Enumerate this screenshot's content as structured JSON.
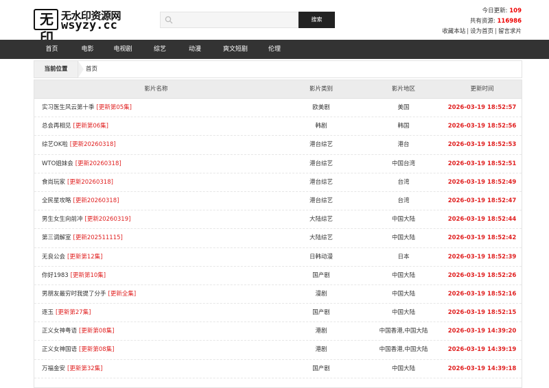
{
  "logo": {
    "mark": "无印",
    "cn": "无水印资源网",
    "en": "wsyzy.cc"
  },
  "search": {
    "placeholder": "",
    "button": "搜索"
  },
  "stats": {
    "today_label": "今日更新:",
    "today_value": "109",
    "total_label": "共有资源:",
    "total_value": "116986",
    "links": [
      "收藏本站",
      "设为首页",
      "留言求片"
    ]
  },
  "nav": [
    "首页",
    "电影",
    "电视剧",
    "综艺",
    "动漫",
    "爽文短剧",
    "伦理"
  ],
  "breadcrumb": {
    "label": "当前位置",
    "home": "首页"
  },
  "table": {
    "headers": [
      "影片名称",
      "影片类别",
      "影片地区",
      "更新时间"
    ],
    "rows": [
      {
        "title": "实习医生风云第十季",
        "update": "[更新第05集]",
        "category": "欧美剧",
        "region": "美国",
        "time": "2026-03-19 18:52:57"
      },
      {
        "title": "总会再相见",
        "update": "[更新第06集]",
        "category": "韩剧",
        "region": "韩国",
        "time": "2026-03-19 18:52:56"
      },
      {
        "title": "综艺OK啦",
        "update": "[更新20260318]",
        "category": "港台综艺",
        "region": "港台",
        "time": "2026-03-19 18:52:53"
      },
      {
        "title": "WTO姐妹会",
        "update": "[更新20260318]",
        "category": "港台综艺",
        "region": "中国台湾",
        "time": "2026-03-19 18:52:51"
      },
      {
        "title": "食尚玩家",
        "update": "[更新20260318]",
        "category": "港台综艺",
        "region": "台湾",
        "time": "2026-03-19 18:52:49"
      },
      {
        "title": "全民星攻略",
        "update": "[更新20260318]",
        "category": "港台综艺",
        "region": "台湾",
        "time": "2026-03-19 18:52:47"
      },
      {
        "title": "男生女生向前冲",
        "update": "[更新20260319]",
        "category": "大陆综艺",
        "region": "中国大陆",
        "time": "2026-03-19 18:52:44"
      },
      {
        "title": "第三调解室",
        "update": "[更新202511115]",
        "category": "大陆综艺",
        "region": "中国大陆",
        "time": "2026-03-19 18:52:42"
      },
      {
        "title": "无良公会",
        "update": "[更新第12集]",
        "category": "日韩动漫",
        "region": "日本",
        "time": "2026-03-19 18:52:39"
      },
      {
        "title": "你好1983",
        "update": "[更新第10集]",
        "category": "国产剧",
        "region": "中国大陆",
        "time": "2026-03-19 18:52:26"
      },
      {
        "title": "男朋友最穷时我提了分手",
        "update": "[更新全集]",
        "category": "漫剧",
        "region": "中国大陆",
        "time": "2026-03-19 18:52:16"
      },
      {
        "title": "逐玉",
        "update": "[更新第27集]",
        "category": "国产剧",
        "region": "中国大陆",
        "time": "2026-03-19 18:52:15"
      },
      {
        "title": "正义女神粤语",
        "update": "[更新第08集]",
        "category": "港剧",
        "region": "中国香港,中国大陆",
        "time": "2026-03-19 14:39:20"
      },
      {
        "title": "正义女神国语",
        "update": "[更新第08集]",
        "category": "港剧",
        "region": "中国香港,中国大陆",
        "time": "2026-03-19 14:39:19"
      },
      {
        "title": "万福金安",
        "update": "[更新第32集]",
        "category": "国产剧",
        "region": "中国大陆",
        "time": "2026-03-19 14:39:18"
      }
    ]
  },
  "colors": {
    "accent_red": "#e02020",
    "nav_bg": "#333333",
    "header_bg": "#ececec"
  }
}
